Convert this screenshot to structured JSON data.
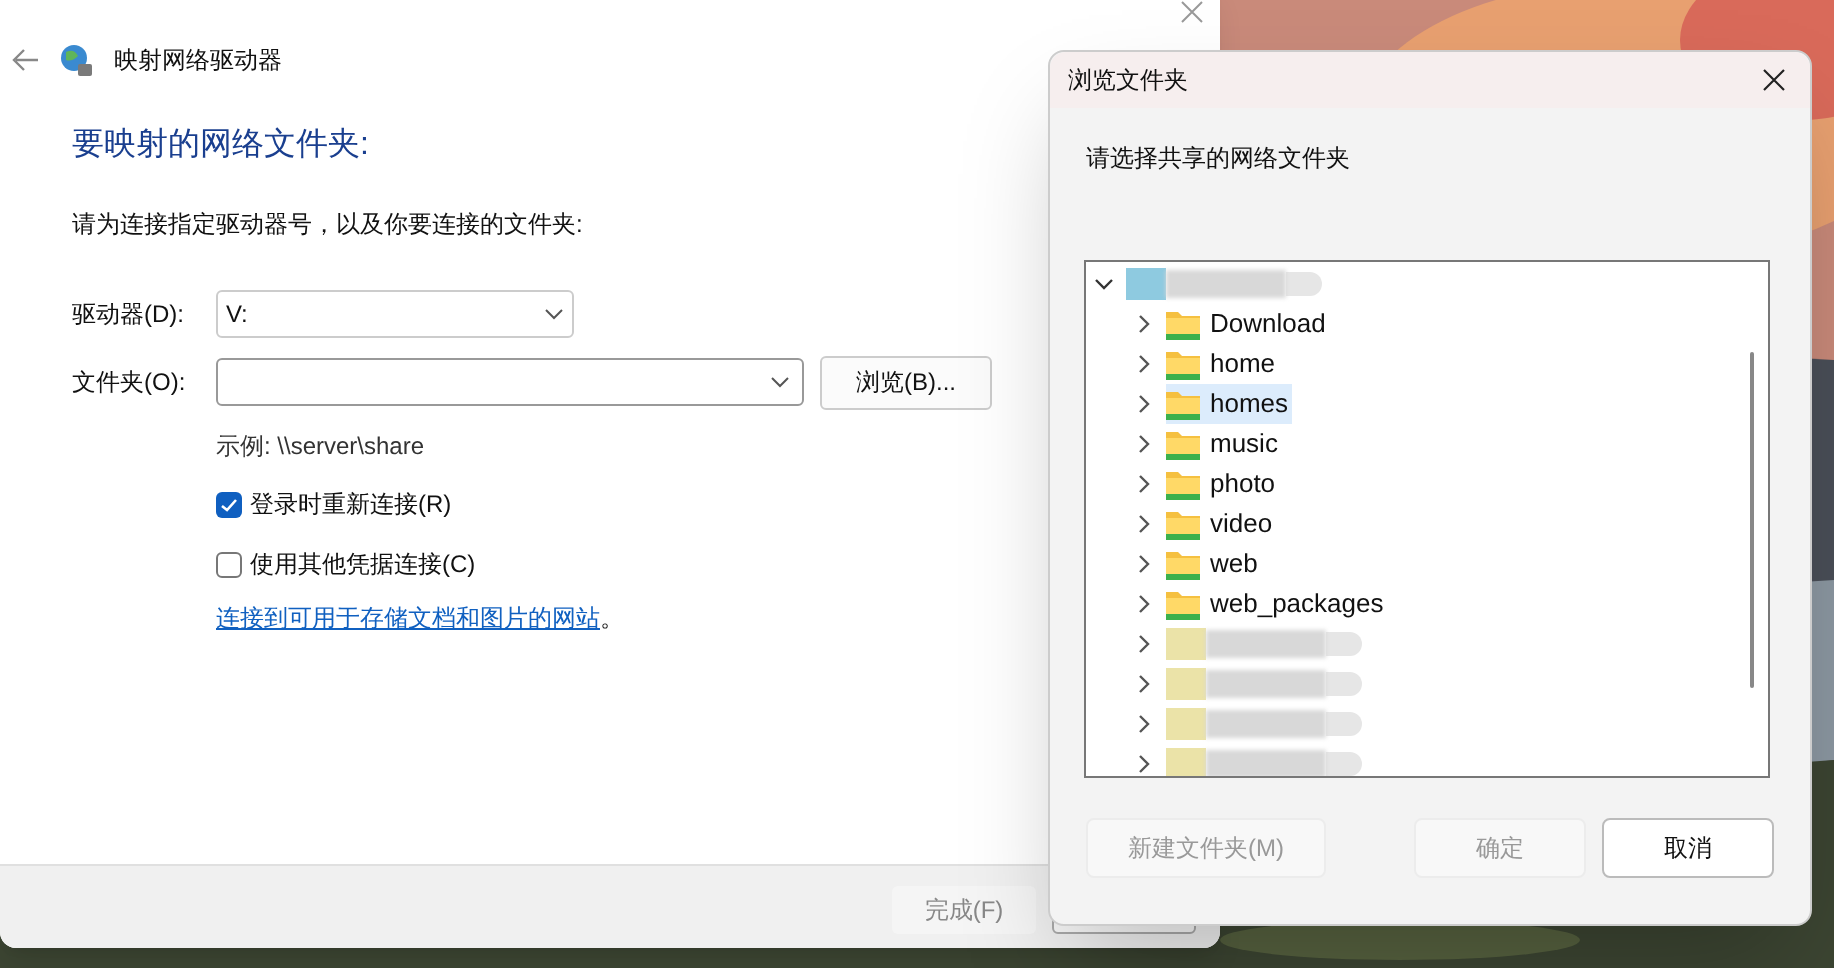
{
  "main_window": {
    "title": "映射网络驱动器",
    "heading": "要映射的网络文件夹:",
    "instruction": "请为连接指定驱动器号，以及你要连接的文件夹:",
    "drive": {
      "label": "驱动器(D):",
      "value": "V:"
    },
    "folder": {
      "label": "文件夹(O):"
    },
    "browse_button": "浏览(B)...",
    "example": "示例: \\\\server\\share",
    "options": [
      {
        "label": "登录时重新连接(R)",
        "checked": true
      },
      {
        "label": "使用其他凭据连接(C)",
        "checked": false
      }
    ],
    "link": "连接到可用于存储文档和图片的网站",
    "link_suffix": "。",
    "footer_buttons": [
      {
        "label": "完成(F)",
        "disabled": true
      }
    ]
  },
  "dialog": {
    "title": "浏览文件夹",
    "prompt": "请选择共享的网络文件夹",
    "tree": [
      {
        "kind": "redacted",
        "expanded": true,
        "selected": false,
        "children": [
          {
            "kind": "folder",
            "label": "Download",
            "expanded": false,
            "selected": false
          },
          {
            "kind": "folder",
            "label": "home",
            "expanded": false,
            "selected": false
          },
          {
            "kind": "folder",
            "label": "homes",
            "expanded": false,
            "selected": true
          },
          {
            "kind": "folder",
            "label": "music",
            "expanded": false,
            "selected": false
          },
          {
            "kind": "folder",
            "label": "photo",
            "expanded": false,
            "selected": false
          },
          {
            "kind": "folder",
            "label": "video",
            "expanded": false,
            "selected": false
          },
          {
            "kind": "folder",
            "label": "web",
            "expanded": false,
            "selected": false
          },
          {
            "kind": "folder",
            "label": "web_packages",
            "expanded": false,
            "selected": false
          },
          {
            "kind": "redacted",
            "expanded": false,
            "selected": false
          },
          {
            "kind": "redacted",
            "expanded": false,
            "selected": false
          },
          {
            "kind": "redacted",
            "expanded": false,
            "selected": false
          },
          {
            "kind": "redacted",
            "expanded": false,
            "selected": false
          }
        ]
      }
    ],
    "buttons": [
      {
        "label": "新建文件夹(M)",
        "disabled": true
      },
      {
        "label": "确定",
        "disabled": true
      },
      {
        "label": "取消",
        "disabled": false
      }
    ]
  }
}
